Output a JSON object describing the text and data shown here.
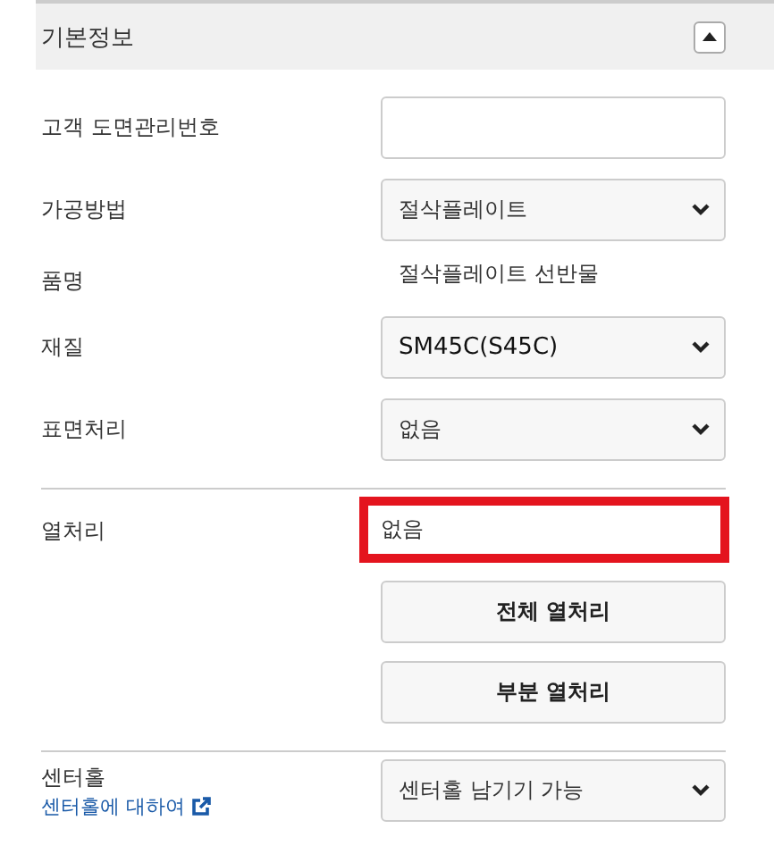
{
  "section": {
    "title": "기본정보",
    "expanded": true
  },
  "groups": [
    {
      "rows": [
        {
          "kind": "input",
          "label": "고객 도면관리번호"
        },
        {
          "kind": "select",
          "label": "가공방법",
          "value": "절삭플레이트"
        },
        {
          "kind": "text",
          "label": "품명",
          "value": "절삭플레이트 선반물"
        },
        {
          "kind": "select",
          "label": "재질",
          "value": "SM45C(S45C)",
          "strong": true
        },
        {
          "kind": "select",
          "label": "표면처리",
          "value": "없음"
        }
      ]
    },
    {
      "rows": [
        {
          "kind": "display",
          "label": "열처리",
          "value": "없음",
          "highlighted": true,
          "buttons": [
            "전체 열처리",
            "부분 열처리"
          ]
        }
      ]
    },
    {
      "rows": [
        {
          "kind": "select",
          "label": "센터홀",
          "link": "센터홀에 대하여",
          "value": "센터홀 남기기 가능"
        }
      ]
    }
  ]
}
